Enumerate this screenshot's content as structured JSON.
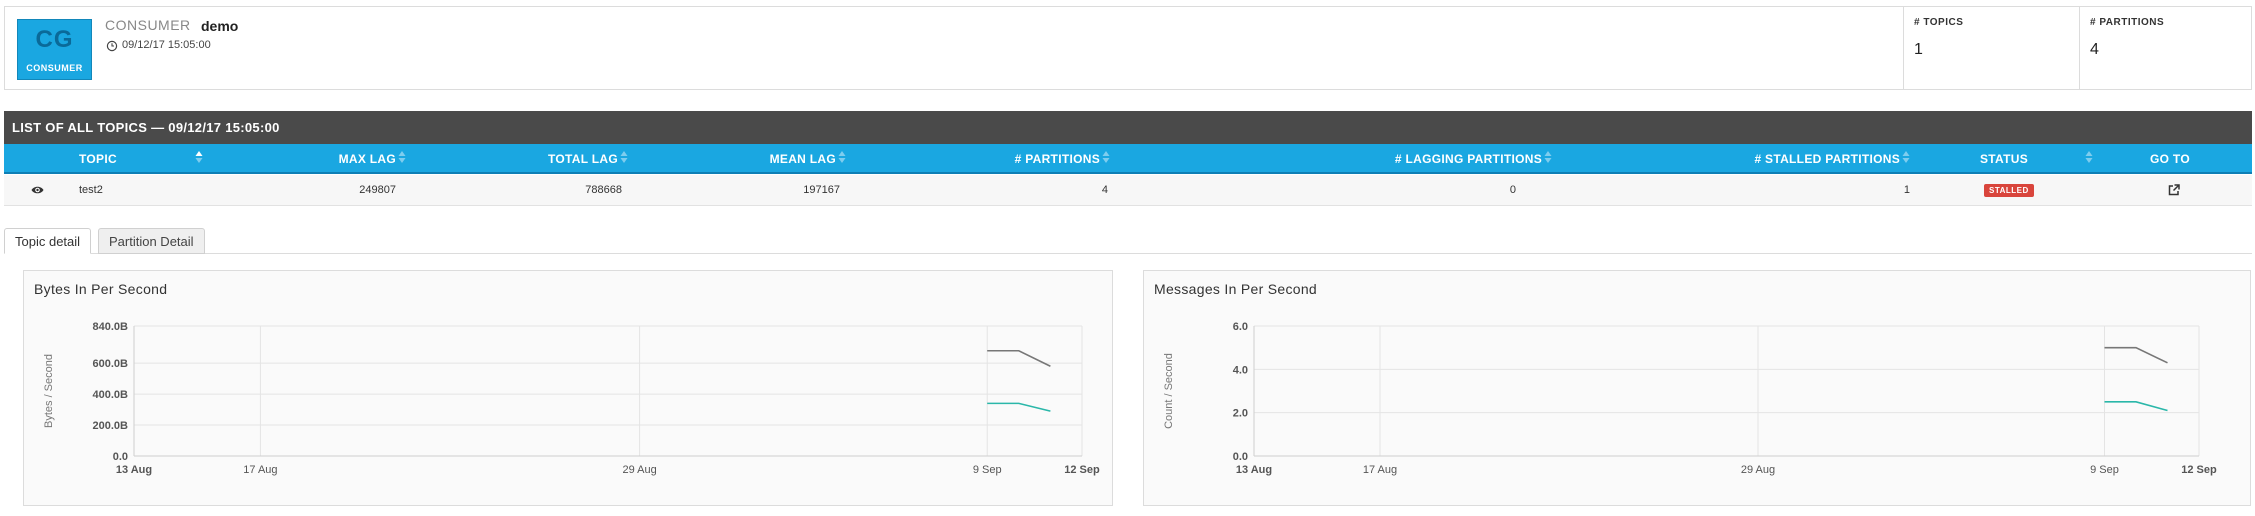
{
  "header": {
    "badge_abbrev": "CG",
    "badge_label": "CONSUMER",
    "consumer_type": "CONSUMER",
    "consumer_name": "demo",
    "timestamp": "09/12/17 15:05:00",
    "stats": [
      {
        "label": "# TOPICS",
        "value": "1"
      },
      {
        "label": "# PARTITIONS",
        "value": "4"
      }
    ]
  },
  "topic_list": {
    "title": "LIST OF ALL TOPICS — 09/12/17 15:05:00",
    "columns": [
      "TOPIC",
      "MAX LAG",
      "TOTAL LAG",
      "MEAN LAG",
      "# PARTITIONS",
      "# LAGGING PARTITIONS",
      "# STALLED PARTITIONS",
      "STATUS",
      "GO TO"
    ],
    "rows": [
      {
        "topic": "test2",
        "max_lag": "249807",
        "total_lag": "788668",
        "mean_lag": "197167",
        "partitions": "4",
        "lagging_partitions": "0",
        "stalled_partitions": "1",
        "status": "STALLED"
      }
    ]
  },
  "tabs": [
    {
      "label": "Topic detail",
      "active": true
    },
    {
      "label": "Partition Detail",
      "active": false
    }
  ],
  "chart_data": [
    {
      "type": "line",
      "title": "Bytes In Per Second",
      "ylabel": "Bytes / Second",
      "xlabel": "",
      "x_ticks": [
        "13 Aug",
        "17 Aug",
        "29 Aug",
        "9 Sep",
        "12 Sep"
      ],
      "x_tick_dates": [
        "2017-08-13",
        "2017-08-17",
        "2017-08-29",
        "2017-09-09",
        "2017-09-12"
      ],
      "y_ticks": [
        "0.0",
        "200.0B",
        "400.0B",
        "600.0B",
        "840.0B"
      ],
      "y_tick_values": [
        0,
        200,
        400,
        600,
        840
      ],
      "ylim": [
        0,
        840
      ],
      "xlim": [
        "2017-08-13",
        "2017-09-12"
      ],
      "grid": true,
      "series": [
        {
          "color": "#777777",
          "x": [
            "2017-09-09",
            "2017-09-10",
            "2017-09-11"
          ],
          "values": [
            680,
            680,
            580
          ]
        },
        {
          "color": "#2ab7a9",
          "x": [
            "2017-09-09",
            "2017-09-10",
            "2017-09-11"
          ],
          "values": [
            340,
            340,
            290
          ]
        }
      ]
    },
    {
      "type": "line",
      "title": "Messages In Per Second",
      "ylabel": "Count / Second",
      "xlabel": "",
      "x_ticks": [
        "13 Aug",
        "17 Aug",
        "29 Aug",
        "9 Sep",
        "12 Sep"
      ],
      "x_tick_dates": [
        "2017-08-13",
        "2017-08-17",
        "2017-08-29",
        "2017-09-09",
        "2017-09-12"
      ],
      "y_ticks": [
        "0.0",
        "2.0",
        "4.0",
        "6.0"
      ],
      "y_tick_values": [
        0,
        2,
        4,
        6
      ],
      "ylim": [
        0,
        6
      ],
      "xlim": [
        "2017-08-13",
        "2017-09-12"
      ],
      "grid": true,
      "series": [
        {
          "color": "#777777",
          "x": [
            "2017-09-09",
            "2017-09-10",
            "2017-09-11"
          ],
          "values": [
            5,
            5,
            4.3
          ]
        },
        {
          "color": "#2ab7a9",
          "x": [
            "2017-09-09",
            "2017-09-10",
            "2017-09-11"
          ],
          "values": [
            2.5,
            2.5,
            2.1
          ]
        }
      ]
    }
  ],
  "colors": {
    "accent": "#1aa7e1",
    "titlebar": "#4a4a4a",
    "status_stalled": "#d9453c"
  }
}
